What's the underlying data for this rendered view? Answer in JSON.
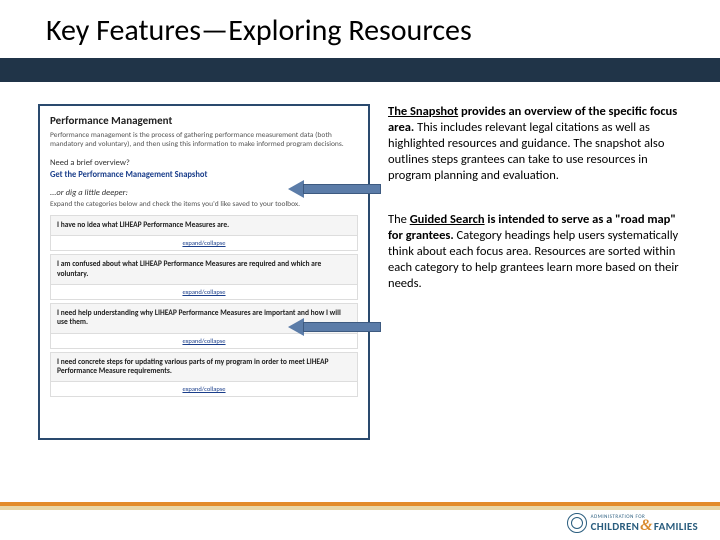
{
  "title": "Key Features—Exploring Resources",
  "panel": {
    "heading": "Performance Management",
    "intro": "Performance management is the process of gathering performance measurement data (both mandatory and voluntary), and then using this information to make informed program decisions.",
    "overview_q": "Need a brief overview?",
    "overview_link": "Get the Performance Management Snapshot",
    "deeper": "...or dig a little deeper:",
    "expand_note": "Expand the categories below and check the items you'd like saved to your toolbox.",
    "acc": [
      "I have no idea what LIHEAP Performance Measures are.",
      "I am confused about what LIHEAP Performance Measures are required and which are voluntary.",
      "I need help understanding why LIHEAP Performance Measures are important and how I will use them.",
      "I need concrete steps for updating various parts of my program in order to meet LIHEAP Performance Measure requirements."
    ],
    "expand_label": "expand/collapse"
  },
  "rhs": {
    "p1_lead": "The Snapshot",
    "p1_rest": " provides an overview of the specific focus area.",
    "p1_body": "  This includes relevant legal citations as well as highlighted resources and guidance.  The snapshot also outlines steps grantees can take to use resources in program planning and evaluation.",
    "p2_pre": "The ",
    "p2_lead": "Guided Search",
    "p2_rest": " is intended to serve as a \"road map\" for grantees.",
    "p2_body": "  Category headings help users systematically think about each focus area.  Resources are sorted within each category to help grantees learn more based on their needs."
  },
  "logo": {
    "top": "ADMINISTRATION FOR",
    "children": "CHILDREN",
    "families": "FAMILIES"
  }
}
